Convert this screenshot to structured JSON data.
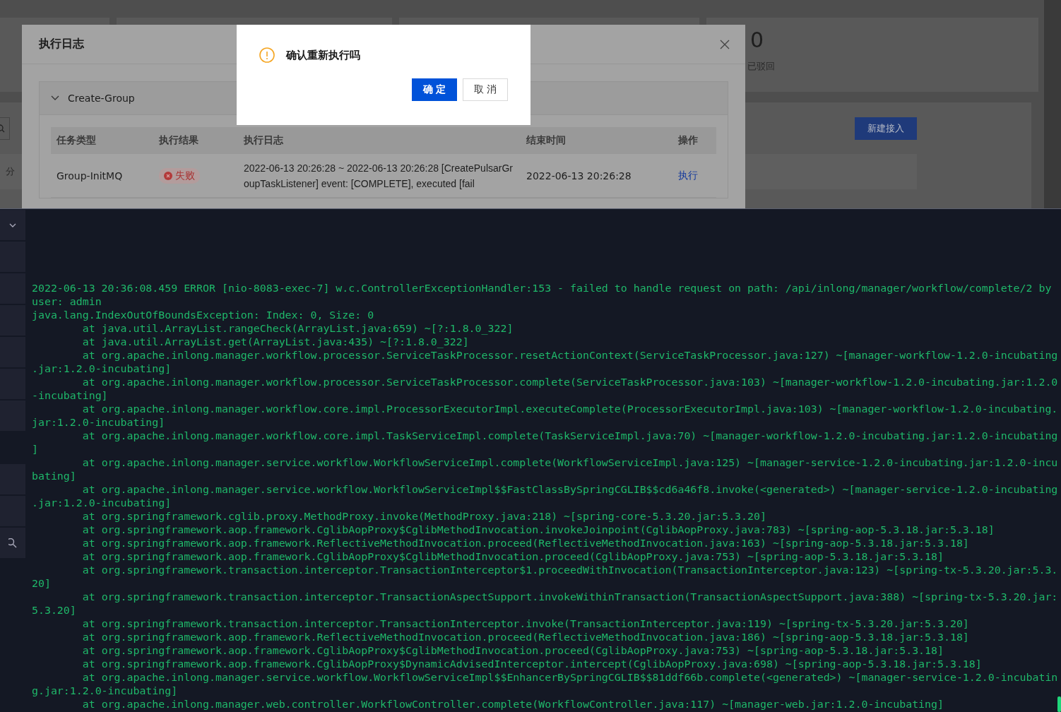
{
  "background_page": {
    "stat_value": "0",
    "stat_label": "已驳回",
    "filter_label": "分",
    "new_button": "新建接入"
  },
  "log_modal": {
    "title": "执行日志",
    "group": {
      "name": "Create-Group",
      "expanded": true,
      "columns": [
        "任务类型",
        "执行结果",
        "执行日志",
        "结束时间",
        "操作"
      ],
      "rows": [
        {
          "task_type": "Group-InitMQ",
          "result": {
            "label": "失败",
            "kind": "failed"
          },
          "log": "2022-06-13 20:26:28 ~ 2022-06-13 20:26:28 [CreatePulsarGroupTaskListener] event: [COMPLETE], executed [fail",
          "end_time": "2022-06-13 20:26:28",
          "action": "执行"
        }
      ]
    }
  },
  "confirm": {
    "title": "确认重新执行吗",
    "buttons": [
      {
        "label": "确 定",
        "kind": "primary"
      },
      {
        "label": "取 消",
        "kind": "default"
      }
    ]
  },
  "terminal": {
    "lines": [
      "2022-06-13 20:36:08.459 ERROR [nio-8083-exec-7] w.c.ControllerExceptionHandler:153 - failed to handle request on path: /api/inlong/manager/workflow/complete/2 by",
      "user: admin",
      "java.lang.IndexOutOfBoundsException: Index: 0, Size: 0",
      "\tat java.util.ArrayList.rangeCheck(ArrayList.java:659) ~[?:1.8.0_322]",
      "\tat java.util.ArrayList.get(ArrayList.java:435) ~[?:1.8.0_322]",
      "\tat org.apache.inlong.manager.workflow.processor.ServiceTaskProcessor.resetActionContext(ServiceTaskProcessor.java:127) ~[manager-workflow-1.2.0-incubating",
      ".jar:1.2.0-incubating]",
      "\tat org.apache.inlong.manager.workflow.processor.ServiceTaskProcessor.complete(ServiceTaskProcessor.java:103) ~[manager-workflow-1.2.0-incubating.jar:1.2.0",
      "-incubating]",
      "\tat org.apache.inlong.manager.workflow.core.impl.ProcessorExecutorImpl.executeComplete(ProcessorExecutorImpl.java:103) ~[manager-workflow-1.2.0-incubating.",
      "jar:1.2.0-incubating]",
      "\tat org.apache.inlong.manager.workflow.core.impl.TaskServiceImpl.complete(TaskServiceImpl.java:70) ~[manager-workflow-1.2.0-incubating.jar:1.2.0-incubating",
      "]",
      "\tat org.apache.inlong.manager.service.workflow.WorkflowServiceImpl.complete(WorkflowServiceImpl.java:125) ~[manager-service-1.2.0-incubating.jar:1.2.0-incu",
      "bating]",
      "\tat org.apache.inlong.manager.service.workflow.WorkflowServiceImpl$$FastClassBySpringCGLIB$$cd6a46f8.invoke(<generated>) ~[manager-service-1.2.0-incubating",
      ".jar:1.2.0-incubating]",
      "\tat org.springframework.cglib.proxy.MethodProxy.invoke(MethodProxy.java:218) ~[spring-core-5.3.20.jar:5.3.20]",
      "\tat org.springframework.aop.framework.CglibAopProxy$CglibMethodInvocation.invokeJoinpoint(CglibAopProxy.java:783) ~[spring-aop-5.3.18.jar:5.3.18]",
      "\tat org.springframework.aop.framework.ReflectiveMethodInvocation.proceed(ReflectiveMethodInvocation.java:163) ~[spring-aop-5.3.18.jar:5.3.18]",
      "\tat org.springframework.aop.framework.CglibAopProxy$CglibMethodInvocation.proceed(CglibAopProxy.java:753) ~[spring-aop-5.3.18.jar:5.3.18]",
      "\tat org.springframework.transaction.interceptor.TransactionInterceptor$1.proceedWithInvocation(TransactionInterceptor.java:123) ~[spring-tx-5.3.20.jar:5.3.",
      "20]",
      "\tat org.springframework.transaction.interceptor.TransactionAspectSupport.invokeWithinTransaction(TransactionAspectSupport.java:388) ~[spring-tx-5.3.20.jar:",
      "5.3.20]",
      "\tat org.springframework.transaction.interceptor.TransactionInterceptor.invoke(TransactionInterceptor.java:119) ~[spring-tx-5.3.20.jar:5.3.20]",
      "\tat org.springframework.aop.framework.ReflectiveMethodInvocation.proceed(ReflectiveMethodInvocation.java:186) ~[spring-aop-5.3.18.jar:5.3.18]",
      "\tat org.springframework.aop.framework.CglibAopProxy$CglibMethodInvocation.proceed(CglibAopProxy.java:753) ~[spring-aop-5.3.18.jar:5.3.18]",
      "\tat org.springframework.aop.framework.CglibAopProxy$DynamicAdvisedInterceptor.intercept(CglibAopProxy.java:698) ~[spring-aop-5.3.18.jar:5.3.18]",
      "\tat org.apache.inlong.manager.service.workflow.WorkflowServiceImpl$$EnhancerBySpringCGLIB$$81ddf66b.complete(<generated>) ~[manager-service-1.2.0-incubatin",
      "g.jar:1.2.0-incubating]",
      "\tat org.apache.inlong.manager.web.controller.WorkflowController.complete(WorkflowController.java:117) ~[manager-web.jar:1.2.0-incubating]"
    ]
  }
}
